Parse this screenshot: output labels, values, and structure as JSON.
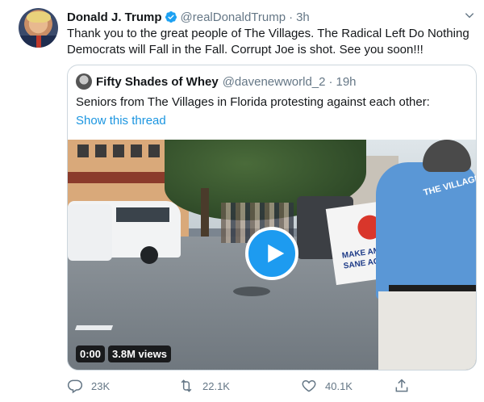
{
  "tweet": {
    "author_name": "Donald J. Trump",
    "author_handle": "@realDonaldTrump",
    "separator": "·",
    "time": "3h",
    "text": "Thank you to the great people of The Villages. The Radical Left Do Nothing Democrats will Fall in the Fall. Corrupt Joe is shot. See you soon!!!"
  },
  "quote": {
    "author_name": "Fifty Shades of Whey",
    "author_handle": "@davenewworld_2",
    "separator": "·",
    "time": "19h",
    "text": "Seniors from The Villages in Florida protesting against each other:",
    "show_thread": "Show this thread"
  },
  "video": {
    "duration": "0:00",
    "views": "3.8M views",
    "shirt_text": "THE VILLAGES",
    "sign_line1": "MAKE AME",
    "sign_line2": "SANE AG"
  },
  "actions": {
    "reply_count": "23K",
    "retweet_count": "22.1K",
    "like_count": "40.1K"
  },
  "colors": {
    "accent": "#1b95e0",
    "play_button": "#1d9bf0",
    "muted": "#657786",
    "border": "#ccd6dd"
  },
  "icons": {
    "verified": "verified-badge-icon",
    "caret": "chevron-down-icon",
    "reply": "reply-icon",
    "retweet": "retweet-icon",
    "like": "heart-icon",
    "share": "share-icon",
    "play": "play-icon"
  }
}
